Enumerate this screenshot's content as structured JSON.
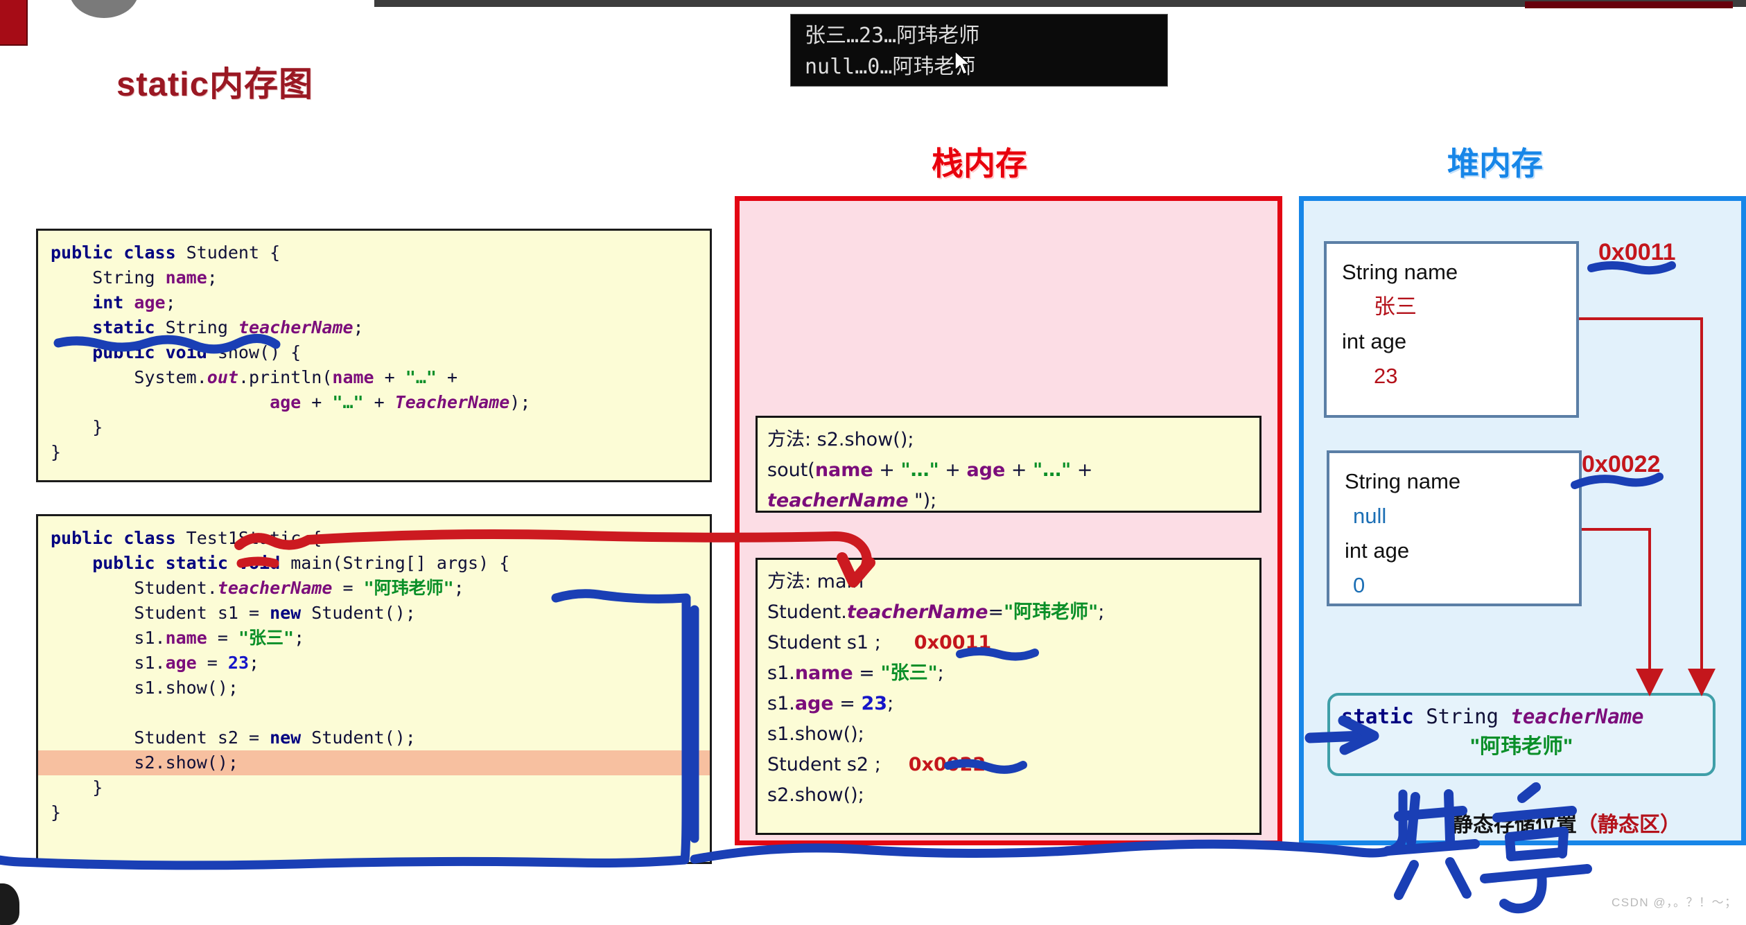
{
  "slide": {
    "title": "static内存图"
  },
  "console": {
    "line1": "张三…23…阿玮老师",
    "line2": "null…0…阿玮老师"
  },
  "headings": {
    "stack": "栈内存",
    "heap": "堆内存"
  },
  "code_student": {
    "l1_kw": "public class",
    "l1_name": " Student {",
    "l2_type": "    String ",
    "l2_fld": "name",
    "l2_end": ";",
    "l3_type": "    int ",
    "l3_fld": "age",
    "l3_end": ";",
    "l4_kw": "    static ",
    "l4_type": "String ",
    "l4_itl": "teacherName",
    "l4_end": ";",
    "l5_kw": "    public void ",
    "l5_rest": "show() {",
    "l6_a": "        System.",
    "l6_out": "out",
    "l6_b": ".println(",
    "l6_name": "name",
    "l6_c": " + ",
    "l6_dots": "\"…\"",
    "l6_d": " + ",
    "l7_age": "                     age",
    "l7_a": " + ",
    "l7_dots": "\"…\"",
    "l7_b": " + ",
    "l7_tn": "TeacherName",
    "l7_end": ");",
    "l8": "    }",
    "l9": "}"
  },
  "code_test": {
    "l1_kw": "public class",
    "l1_name": " Test1Static {",
    "l2_kw": "    public static void ",
    "l2_rest": "main(String[] args) {",
    "l3_a": "        Student.",
    "l3_itl": "teacherName",
    "l3_b": " = ",
    "l3_str": "\"阿玮老师\"",
    "l3_end": ";",
    "l4": "        Student s1 = ",
    "l4_new": "new",
    "l4_end": " Student();",
    "l5_a": "        s1.",
    "l5_fld": "name",
    "l5_b": " = ",
    "l5_str": "\"张三\"",
    "l5_end": ";",
    "l6_a": "        s1.",
    "l6_fld": "age",
    "l6_b": " = ",
    "l6_num": "23",
    "l6_end": ";",
    "l7": "        s1.show();",
    "l8": "",
    "l9": "        Student s2 = ",
    "l9_new": "new",
    "l9_end": " Student();",
    "l10_highlight": "        s2.show();",
    "l11": "    }",
    "l12": "}"
  },
  "stack_frames": [
    {
      "title": "方法: s2.show();",
      "line2_a": "sout(",
      "line2_name": "name",
      "line2_b": " + ",
      "line2_dots1": "\"…\"",
      "line2_c": " + ",
      "line2_age": "age",
      "line2_d": " + ",
      "line2_dots2": "\"…\"",
      "line2_e": " + ",
      "line3_tn": "teacherName",
      "line3_end": " \");"
    },
    {
      "title": "方法: main",
      "l2_a": "Student.",
      "l2_itl": "teacherName",
      "l2_eq": "=",
      "l2_str": "\"阿玮老师\"",
      "l2_end": ";",
      "l3": "Student s1 ;",
      "l3_addr": "0x0011",
      "l4_a": "s1.",
      "l4_fld": "name",
      "l4_b": " = ",
      "l4_str": "\"张三\"",
      "l4_end": ";",
      "l5_a": "s1.",
      "l5_fld": "age",
      "l5_b": " = ",
      "l5_num": "23",
      "l5_end": ";",
      "l6": "s1.show();",
      "l7": "Student s2 ;",
      "l7_addr": "0x0022",
      "l8": "s2.show();"
    }
  ],
  "heap_objects": [
    {
      "field1_label": "String name",
      "field1_value": "张三",
      "field2_label": "int age",
      "field2_value": "23",
      "address": "0x0011"
    },
    {
      "field1_label": "String name",
      "field1_value": "null",
      "field2_label": "int age",
      "field2_value": "0",
      "address": "0x0022"
    }
  ],
  "static_area": {
    "kw": "static",
    "type": " String ",
    "name": "teacherName",
    "value": "\"阿玮老师\"",
    "caption_main": "静态存储位置",
    "caption_zone": "（静态区）"
  },
  "annotations": {
    "shared_note": "共享"
  },
  "watermark": "CSDN @，。？！～；",
  "colors": {
    "title_red": "#9a1823",
    "stack_red": "#e30613",
    "heap_blue": "#1786e8",
    "ink_blue": "#1a3fb5",
    "ink_red": "#cc1a20",
    "string_green": "#0a8f28",
    "address_red": "#c4161c",
    "static_teal": "#3f9fa8",
    "code_bg": "#fcfcd6",
    "stack_bg": "#fcdde5",
    "heap_bg": "#e2f1fb",
    "highlight_orange": "#f7c0a0"
  }
}
